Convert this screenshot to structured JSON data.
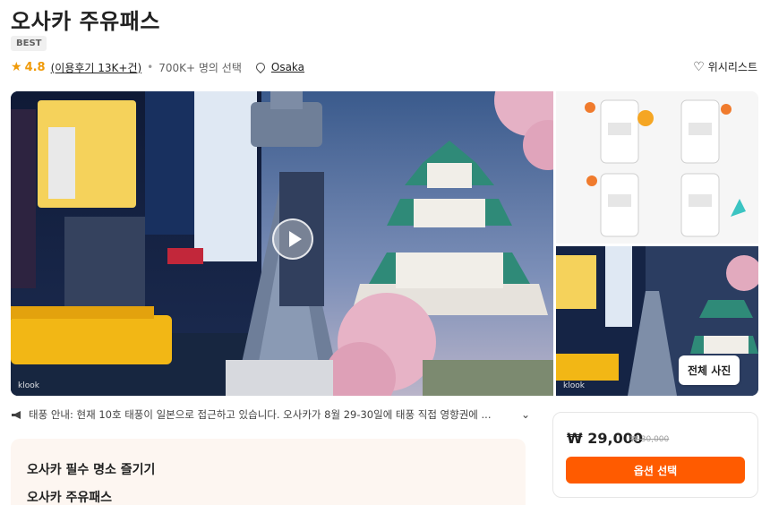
{
  "title": "오사카 주유패스",
  "badge": "BEST",
  "rating": {
    "score": "4.8",
    "reviews_link": "(이용후기 13K+건)",
    "separator": "•",
    "booked": "700K+ 명의 선택",
    "location": "Osaka"
  },
  "wishlist_label": "위시리스트",
  "gallery": {
    "watermark": "klook",
    "all_photos_label": "전체 사진"
  },
  "notice": {
    "text": "태풍 안내: 현재 10호 태풍이 일본으로 접근하고 있습니다. 오사카가 8월 29-30일에 태풍 직접 영향권에 ..."
  },
  "info": {
    "heading1": "오사카 필수 명소 즐기기",
    "heading2": "오사카 주유패스"
  },
  "booking": {
    "price": "₩ 29,000",
    "original_price": "₩ 30,000",
    "select_label": "옵션 선택"
  },
  "colors": {
    "accent": "#ff5b00",
    "star": "#f09b0a"
  }
}
